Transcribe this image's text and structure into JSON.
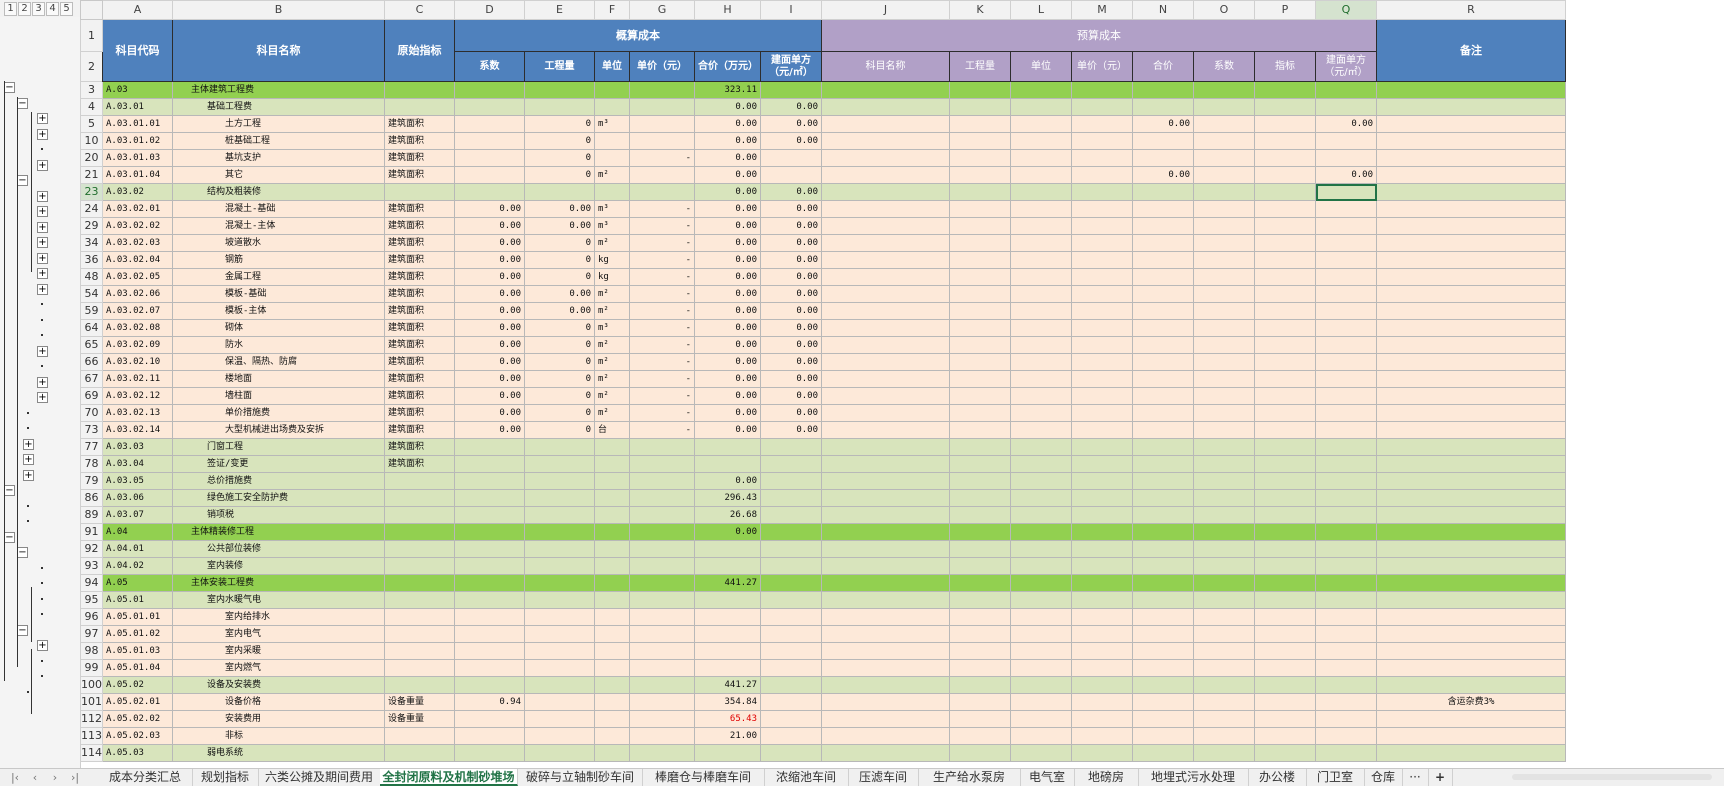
{
  "outline_levels": [
    "1",
    "2",
    "3",
    "4",
    "5"
  ],
  "columns": [
    "A",
    "B",
    "C",
    "D",
    "E",
    "F",
    "G",
    "H",
    "I",
    "J",
    "K",
    "L",
    "M",
    "N",
    "O",
    "P",
    "Q",
    "R"
  ],
  "selected_column": "Q",
  "selected_row": "23",
  "header": {
    "row1": "1",
    "row2": "2",
    "a": "科目代码",
    "b": "科目名称",
    "c": "原始指标",
    "estimate": "概算成本",
    "budget": "预算成本",
    "remark": "备注",
    "d": "系数",
    "e": "工程量",
    "f": "单位",
    "g": "单价（元）",
    "h": "合价（万元）",
    "i": "建面单方（元/㎡）",
    "j": "科目名称",
    "k": "工程量",
    "l": "单位",
    "m": "单价（元）",
    "n": "合价",
    "o": "系数",
    "p": "指标",
    "q": "建面单方（元/㎡）"
  },
  "rows": [
    {
      "r": "3",
      "lvl": "g1",
      "cells": [
        "A.03",
        "主体建筑工程费",
        "",
        "",
        "",
        "",
        "",
        "323.11",
        "",
        "",
        "",
        "",
        "",
        "",
        "",
        "",
        "",
        ""
      ]
    },
    {
      "r": "4",
      "lvl": "g2",
      "cells": [
        "A.03.01",
        "基础工程费",
        "",
        "",
        "",
        "",
        "",
        "0.00",
        "0.00",
        "",
        "",
        "",
        "",
        "",
        "",
        "",
        "",
        ""
      ]
    },
    {
      "r": "5",
      "lvl": "g3",
      "cells": [
        "A.03.01.01",
        "土方工程",
        "建筑面积",
        "",
        "0",
        "m³",
        "",
        "0.00",
        "0.00",
        "",
        "",
        "",
        "",
        "0.00",
        "",
        "",
        "0.00",
        ""
      ]
    },
    {
      "r": "10",
      "lvl": "g3",
      "cells": [
        "A.03.01.02",
        "桩基础工程",
        "建筑面积",
        "",
        "0",
        "",
        "",
        "0.00",
        "0.00",
        "",
        "",
        "",
        "",
        "",
        "",
        "",
        "",
        ""
      ]
    },
    {
      "r": "20",
      "lvl": "g3",
      "cells": [
        "A.03.01.03",
        "基坑支护",
        "建筑面积",
        "",
        "0",
        "",
        "-",
        "0.00",
        "",
        "",
        "",
        "",
        "",
        "",
        "",
        "",
        "",
        ""
      ]
    },
    {
      "r": "21",
      "lvl": "g3",
      "cells": [
        "A.03.01.04",
        "其它",
        "建筑面积",
        "",
        "0",
        "m²",
        "",
        "0.00",
        "",
        "",
        "",
        "",
        "",
        "0.00",
        "",
        "",
        "0.00",
        ""
      ]
    },
    {
      "r": "23",
      "lvl": "g2",
      "cells": [
        "A.03.02",
        "结构及粗装修",
        "",
        "",
        "",
        "",
        "",
        "0.00",
        "0.00",
        "",
        "",
        "",
        "",
        "",
        "",
        "",
        "",
        ""
      ]
    },
    {
      "r": "24",
      "lvl": "g3",
      "cells": [
        "A.03.02.01",
        "混凝土-基础",
        "建筑面积",
        "0.00",
        "0.00",
        "m³",
        "-",
        "0.00",
        "0.00",
        "",
        "",
        "",
        "",
        "",
        "",
        "",
        "",
        ""
      ]
    },
    {
      "r": "29",
      "lvl": "g3",
      "cells": [
        "A.03.02.02",
        "混凝土-主体",
        "建筑面积",
        "0.00",
        "0.00",
        "m³",
        "-",
        "0.00",
        "0.00",
        "",
        "",
        "",
        "",
        "",
        "",
        "",
        "",
        ""
      ]
    },
    {
      "r": "34",
      "lvl": "g3",
      "cells": [
        "A.03.02.03",
        "坡道散水",
        "建筑面积",
        "0.00",
        "0",
        "m²",
        "-",
        "0.00",
        "0.00",
        "",
        "",
        "",
        "",
        "",
        "",
        "",
        "",
        ""
      ]
    },
    {
      "r": "36",
      "lvl": "g3",
      "cells": [
        "A.03.02.04",
        "钢筋",
        "建筑面积",
        "0.00",
        "0",
        "kg",
        "-",
        "0.00",
        "0.00",
        "",
        "",
        "",
        "",
        "",
        "",
        "",
        "",
        ""
      ]
    },
    {
      "r": "48",
      "lvl": "g3",
      "cells": [
        "A.03.02.05",
        "金属工程",
        "建筑面积",
        "0.00",
        "0",
        "kg",
        "-",
        "0.00",
        "0.00",
        "",
        "",
        "",
        "",
        "",
        "",
        "",
        "",
        ""
      ]
    },
    {
      "r": "54",
      "lvl": "g3",
      "cells": [
        "A.03.02.06",
        "模板-基础",
        "建筑面积",
        "0.00",
        "0.00",
        "m²",
        "-",
        "0.00",
        "0.00",
        "",
        "",
        "",
        "",
        "",
        "",
        "",
        "",
        ""
      ]
    },
    {
      "r": "59",
      "lvl": "g3",
      "cells": [
        "A.03.02.07",
        "模板-主体",
        "建筑面积",
        "0.00",
        "0.00",
        "m²",
        "-",
        "0.00",
        "0.00",
        "",
        "",
        "",
        "",
        "",
        "",
        "",
        "",
        ""
      ]
    },
    {
      "r": "64",
      "lvl": "g3",
      "cells": [
        "A.03.02.08",
        "砌体",
        "建筑面积",
        "0.00",
        "0",
        "m³",
        "-",
        "0.00",
        "0.00",
        "",
        "",
        "",
        "",
        "",
        "",
        "",
        "",
        ""
      ]
    },
    {
      "r": "65",
      "lvl": "g3",
      "cells": [
        "A.03.02.09",
        "防水",
        "建筑面积",
        "0.00",
        "0",
        "m²",
        "-",
        "0.00",
        "0.00",
        "",
        "",
        "",
        "",
        "",
        "",
        "",
        "",
        ""
      ]
    },
    {
      "r": "66",
      "lvl": "g3",
      "cells": [
        "A.03.02.10",
        "保温、隔热、防腐",
        "建筑面积",
        "0.00",
        "0",
        "m²",
        "-",
        "0.00",
        "0.00",
        "",
        "",
        "",
        "",
        "",
        "",
        "",
        "",
        ""
      ]
    },
    {
      "r": "67",
      "lvl": "g3",
      "cells": [
        "A.03.02.11",
        "楼地面",
        "建筑面积",
        "0.00",
        "0",
        "m²",
        "-",
        "0.00",
        "0.00",
        "",
        "",
        "",
        "",
        "",
        "",
        "",
        "",
        ""
      ]
    },
    {
      "r": "69",
      "lvl": "g3",
      "cells": [
        "A.03.02.12",
        "墙柱面",
        "建筑面积",
        "0.00",
        "0",
        "m²",
        "-",
        "0.00",
        "0.00",
        "",
        "",
        "",
        "",
        "",
        "",
        "",
        "",
        ""
      ]
    },
    {
      "r": "70",
      "lvl": "g3",
      "cells": [
        "A.03.02.13",
        "单价措施费",
        "建筑面积",
        "0.00",
        "0",
        "m²",
        "-",
        "0.00",
        "0.00",
        "",
        "",
        "",
        "",
        "",
        "",
        "",
        "",
        ""
      ]
    },
    {
      "r": "73",
      "lvl": "g3",
      "cells": [
        "A.03.02.14",
        "大型机械进出场费及安拆",
        "建筑面积",
        "0.00",
        "0",
        "台",
        "-",
        "0.00",
        "0.00",
        "",
        "",
        "",
        "",
        "",
        "",
        "",
        "",
        ""
      ]
    },
    {
      "r": "77",
      "lvl": "g2",
      "cells": [
        "A.03.03",
        "门窗工程",
        "建筑面积",
        "",
        "",
        "",
        "",
        "",
        "",
        "",
        "",
        "",
        "",
        "",
        "",
        "",
        "",
        ""
      ]
    },
    {
      "r": "78",
      "lvl": "g2",
      "cells": [
        "A.03.04",
        "签证/变更",
        "建筑面积",
        "",
        "",
        "",
        "",
        "",
        "",
        "",
        "",
        "",
        "",
        "",
        "",
        "",
        "",
        ""
      ]
    },
    {
      "r": "79",
      "lvl": "g2",
      "cells": [
        "A.03.05",
        "总价措施费",
        "",
        "",
        "",
        "",
        "",
        "0.00",
        "",
        "",
        "",
        "",
        "",
        "",
        "",
        "",
        "",
        ""
      ]
    },
    {
      "r": "86",
      "lvl": "g2",
      "cells": [
        "A.03.06",
        "绿色施工安全防护费",
        "",
        "",
        "",
        "",
        "",
        "296.43",
        "",
        "",
        "",
        "",
        "",
        "",
        "",
        "",
        "",
        ""
      ]
    },
    {
      "r": "89",
      "lvl": "g2",
      "cells": [
        "A.03.07",
        "销项税",
        "",
        "",
        "",
        "",
        "",
        "26.68",
        "",
        "",
        "",
        "",
        "",
        "",
        "",
        "",
        "",
        ""
      ]
    },
    {
      "r": "91",
      "lvl": "g1",
      "cells": [
        "A.04",
        "主体精装修工程",
        "",
        "",
        "",
        "",
        "",
        "0.00",
        "",
        "",
        "",
        "",
        "",
        "",
        "",
        "",
        "",
        ""
      ]
    },
    {
      "r": "92",
      "lvl": "g2",
      "cells": [
        "A.04.01",
        "公共部位装修",
        "",
        "",
        "",
        "",
        "",
        "",
        "",
        "",
        "",
        "",
        "",
        "",
        "",
        "",
        "",
        ""
      ]
    },
    {
      "r": "93",
      "lvl": "g2",
      "cells": [
        "A.04.02",
        "室内装修",
        "",
        "",
        "",
        "",
        "",
        "",
        "",
        "",
        "",
        "",
        "",
        "",
        "",
        "",
        "",
        ""
      ]
    },
    {
      "r": "94",
      "lvl": "g1",
      "cells": [
        "A.05",
        "主体安装工程费",
        "",
        "",
        "",
        "",
        "",
        "441.27",
        "",
        "",
        "",
        "",
        "",
        "",
        "",
        "",
        "",
        ""
      ]
    },
    {
      "r": "95",
      "lvl": "g2",
      "cells": [
        "A.05.01",
        "室内水暖气电",
        "",
        "",
        "",
        "",
        "",
        "",
        "",
        "",
        "",
        "",
        "",
        "",
        "",
        "",
        "",
        ""
      ]
    },
    {
      "r": "96",
      "lvl": "g3",
      "cells": [
        "A.05.01.01",
        "室内给排水",
        "",
        "",
        "",
        "",
        "",
        "",
        "",
        "",
        "",
        "",
        "",
        "",
        "",
        "",
        "",
        ""
      ]
    },
    {
      "r": "97",
      "lvl": "g3",
      "cells": [
        "A.05.01.02",
        "室内电气",
        "",
        "",
        "",
        "",
        "",
        "",
        "",
        "",
        "",
        "",
        "",
        "",
        "",
        "",
        "",
        ""
      ]
    },
    {
      "r": "98",
      "lvl": "g3",
      "cells": [
        "A.05.01.03",
        "室内采暖",
        "",
        "",
        "",
        "",
        "",
        "",
        "",
        "",
        "",
        "",
        "",
        "",
        "",
        "",
        "",
        ""
      ]
    },
    {
      "r": "99",
      "lvl": "g3",
      "cells": [
        "A.05.01.04",
        "室内燃气",
        "",
        "",
        "",
        "",
        "",
        "",
        "",
        "",
        "",
        "",
        "",
        "",
        "",
        "",
        "",
        ""
      ]
    },
    {
      "r": "100",
      "lvl": "g2",
      "cells": [
        "A.05.02",
        "设备及安装费",
        "",
        "",
        "",
        "",
        "",
        "441.27",
        "",
        "",
        "",
        "",
        "",
        "",
        "",
        "",
        "",
        ""
      ]
    },
    {
      "r": "101",
      "lvl": "g3",
      "cells": [
        "A.05.02.01",
        "设备价格",
        "设备重量",
        "0.94",
        "",
        "",
        "",
        "354.84",
        "",
        "",
        "",
        "",
        "",
        "",
        "",
        "",
        "",
        "含运杂费3%"
      ]
    },
    {
      "r": "112",
      "lvl": "g3",
      "cells": [
        "A.05.02.02",
        "安装费用",
        "设备重量",
        "",
        "",
        "",
        "",
        "65.43",
        "",
        "",
        "",
        "",
        "",
        "",
        "",
        "",
        "",
        ""
      ]
    },
    {
      "r": "113",
      "lvl": "g3",
      "cells": [
        "A.05.02.03",
        "非标",
        "",
        "",
        "",
        "",
        "",
        "21.00",
        "",
        "",
        "",
        "",
        "",
        "",
        "",
        "",
        "",
        ""
      ]
    },
    {
      "r": "114",
      "lvl": "g2",
      "cells": [
        "A.05.03",
        "弱电系统",
        "",
        "",
        "",
        "",
        "",
        "",
        "",
        "",
        "",
        "",
        "",
        "",
        "",
        "",
        "",
        ""
      ]
    }
  ],
  "sheet_tabs": [
    "成本分类汇总",
    "规划指标",
    "六类公摊及期间费用",
    "全封闭原料及机制砂堆场",
    "破碎与立轴制砂车间",
    "棒磨仓与棒磨车间",
    "浓缩池车间",
    "压滤车间",
    "生产给水泵房",
    "电气室",
    "地磅房",
    "地埋式污水处理",
    "办公楼",
    "门卫室",
    "仓库"
  ],
  "active_tab": "全封闭原料及机制砂堆场",
  "nav_icons": [
    "first-sheet-icon",
    "prev-sheet-icon",
    "next-sheet-icon",
    "last-sheet-icon"
  ],
  "more_tabs": "···",
  "add_sheet": "+",
  "colors": {
    "green_dark": "#92d050",
    "green_light": "#d8e4bc",
    "peach": "#fde9d9",
    "blue_header": "#4f81bd",
    "purple_header": "#b1a0c7",
    "accent": "#217346"
  }
}
